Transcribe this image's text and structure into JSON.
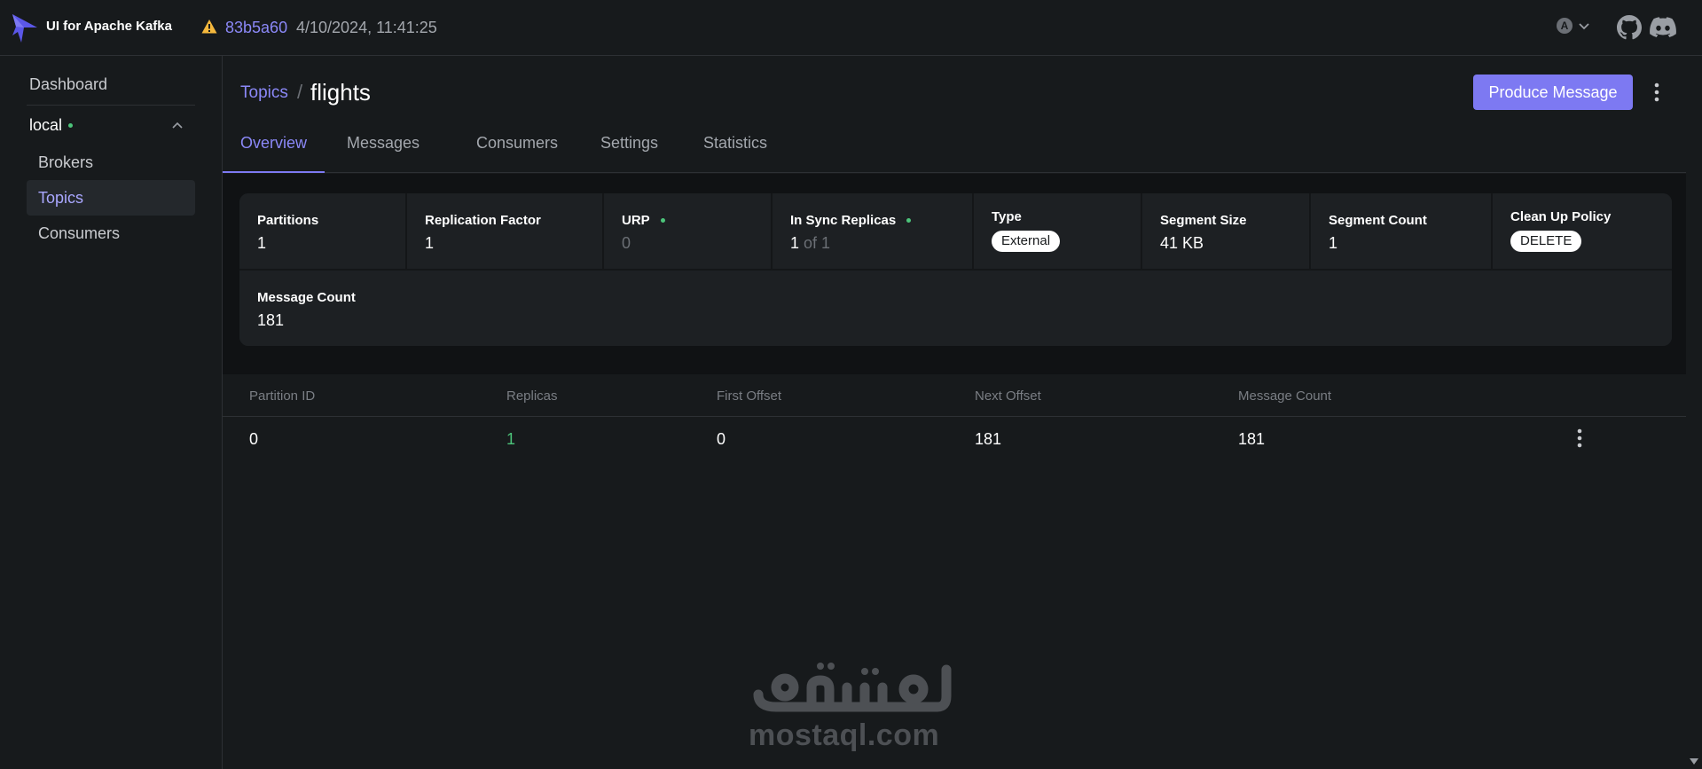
{
  "header": {
    "app_title": "UI for Apache Kafka",
    "commit": "83b5a60",
    "build_date": "4/10/2024, 11:41:25",
    "user_initial": "A"
  },
  "sidebar": {
    "dashboard": "Dashboard",
    "cluster": "local",
    "items": [
      {
        "label": "Brokers",
        "active": false
      },
      {
        "label": "Topics",
        "active": true
      },
      {
        "label": "Consumers",
        "active": false
      }
    ]
  },
  "breadcrumb": {
    "parent": "Topics",
    "separator": "/",
    "current": "flights"
  },
  "actions": {
    "produce_label": "Produce Message"
  },
  "tabs": [
    "Overview",
    "Messages",
    "Consumers",
    "Settings",
    "Statistics"
  ],
  "metrics": {
    "partitions": {
      "label": "Partitions",
      "value": "1"
    },
    "replication": {
      "label": "Replication Factor",
      "value": "1"
    },
    "urp": {
      "label": "URP",
      "value": "0"
    },
    "in_sync": {
      "label": "In Sync Replicas",
      "value": "1",
      "of_text": "of 1"
    },
    "type": {
      "label": "Type",
      "value": "External"
    },
    "segment_size": {
      "label": "Segment Size",
      "value": "41 KB"
    },
    "segment_count": {
      "label": "Segment Count",
      "value": "1"
    },
    "cleanup": {
      "label": "Clean Up Policy",
      "value": "DELETE"
    },
    "message_count": {
      "label": "Message Count",
      "value": "181"
    }
  },
  "table": {
    "headers": [
      "Partition ID",
      "Replicas",
      "First Offset",
      "Next Offset",
      "Message Count"
    ],
    "rows": [
      [
        "0",
        "1",
        "0",
        "181",
        "181"
      ]
    ]
  },
  "watermark": {
    "arabic": "مستقل",
    "text": "mostaql.com"
  },
  "colors": {
    "accent": "#7d79f2",
    "link": "#8b88f7",
    "status_green": "#4cc47a",
    "warning": "#f5b83d",
    "background": "#171a1c"
  }
}
